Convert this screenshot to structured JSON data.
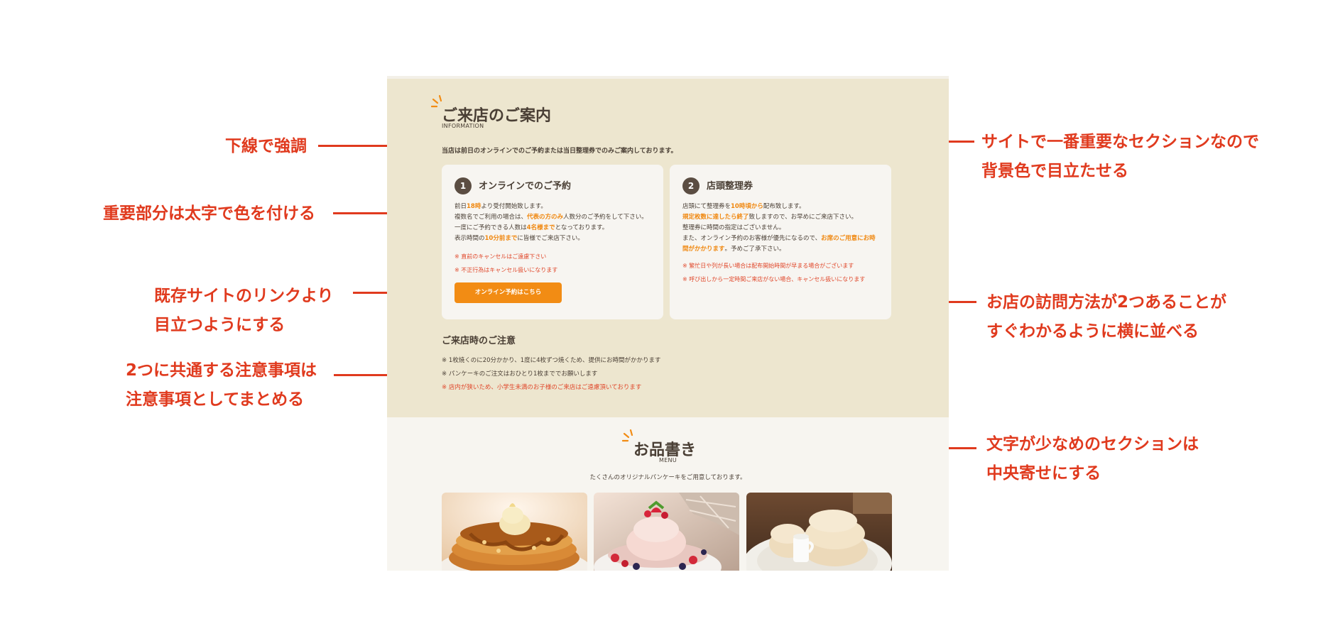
{
  "annotations": {
    "underline_emphasis": "下線で強調",
    "bold_color": "重要部分は太字で色を付ける",
    "link_standout": [
      "既存サイトのリンクより",
      "目立つようにする"
    ],
    "common_notes": [
      "2つに共通する注意事項は",
      "注意事項としてまとめる"
    ],
    "bg_color": [
      "サイトで一番重要なセクションなので",
      "背景色で目立たせる"
    ],
    "side_by_side": [
      "お店の訪問方法が2つあることが",
      "すぐわかるように横に並べる"
    ],
    "center_align": [
      "文字が少なめのセクションは",
      "中央寄せにする"
    ]
  },
  "info_section": {
    "title": "ご来店のご案内",
    "subtitle": "INFORMATION",
    "lead": "当店は前日のオンラインでのご予約または当日整理券でのみご案内しております。"
  },
  "card_online": {
    "number": "1",
    "title": "オンラインでのご予約",
    "lines": [
      [
        "前日",
        "18時",
        "より受付開始致します。"
      ],
      [
        "複数名でご利用の場合は、",
        "代表の方のみ",
        "人数分のご予約をして下さい。"
      ],
      [
        "一度にご予約できる人数は",
        "4名様まで",
        "となっております。"
      ],
      [
        "表示時間の",
        "10分前まで",
        "に皆様でご来店下さい。"
      ]
    ],
    "notes": [
      "※ 直前のキャンセルはご遠慮下さい",
      "※ 不正行為はキャンセル扱いになります"
    ],
    "button_label": "オンライン予約はこちら"
  },
  "card_ticket": {
    "number": "2",
    "title": "店頭整理券",
    "lines": [
      [
        "店頭にて整理券を",
        "10時頃から",
        "配布致します。"
      ],
      [
        "",
        "規定枚数に達したら終了",
        "致しますので、お早めにご来店下さい。"
      ],
      [
        "整理券に時間の指定はございません。",
        "",
        ""
      ],
      [
        "また、オンライン予約のお客様が優先になるので、",
        "お席のご用意にお時",
        ""
      ],
      [
        "",
        "間がかかります",
        "。予めご了承下さい。"
      ]
    ],
    "notes": [
      "※ 繁忙日や列が長い場合は配布開始時間が早まる場合がございます",
      "※ 呼び出しから一定時間ご来店がない場合、キャンセル扱いになります"
    ]
  },
  "caution": {
    "title": "ご来店時のご注意",
    "items": [
      "※ 1枚焼くのに20分かかり、1度に4枚ずつ焼くため、提供にお時間がかかります",
      "※ パンケーキのご注文はおひとり1枚まででお願いします"
    ],
    "red_item": "※ 店内が狭いため、小学生未満のお子様のご来店はご遠慮頂いております"
  },
  "menu_section": {
    "title": "お品書き",
    "subtitle": "MENU",
    "lead": "たくさんのオリジナルパンケーキをご用意しております。"
  },
  "colors": {
    "annotation_red": "#e03a1e",
    "accent_orange": "#f28c14",
    "info_bg": "#ede6cf",
    "card_bg": "#f7f5f1",
    "text_brown": "#4a3f35"
  },
  "icons": {
    "title_deco": "sunburst-icon",
    "photos": [
      "pancake-caramel-photo",
      "pancake-strawberry-photo",
      "souffle-pancake-photo"
    ]
  }
}
